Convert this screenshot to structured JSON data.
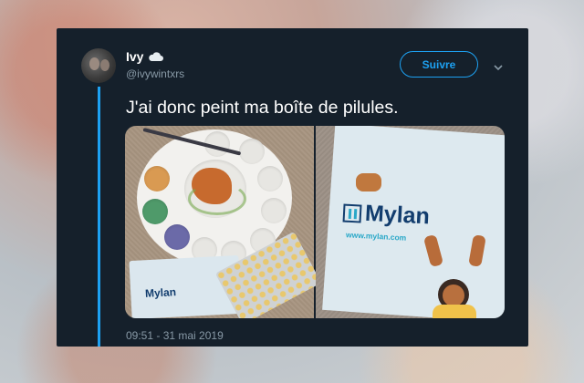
{
  "tweet": {
    "display_name": "Ivy",
    "name_emoji": "cloud-icon",
    "handle": "@ivywintxrs",
    "follow_label": "Suivre",
    "text": "J'ai donc peint ma boîte de pilules.",
    "timestamp": "09:51 - 31 mai 2019"
  },
  "media": {
    "left_image": {
      "box_brand": "Mylan"
    },
    "right_image": {
      "box_brand": "Mylan",
      "box_url": "www.mylan.com"
    }
  },
  "colors": {
    "card_bg": "#15202b",
    "accent": "#1da1f2",
    "secondary_text": "#8899a6",
    "primary_text": "#ffffff"
  }
}
